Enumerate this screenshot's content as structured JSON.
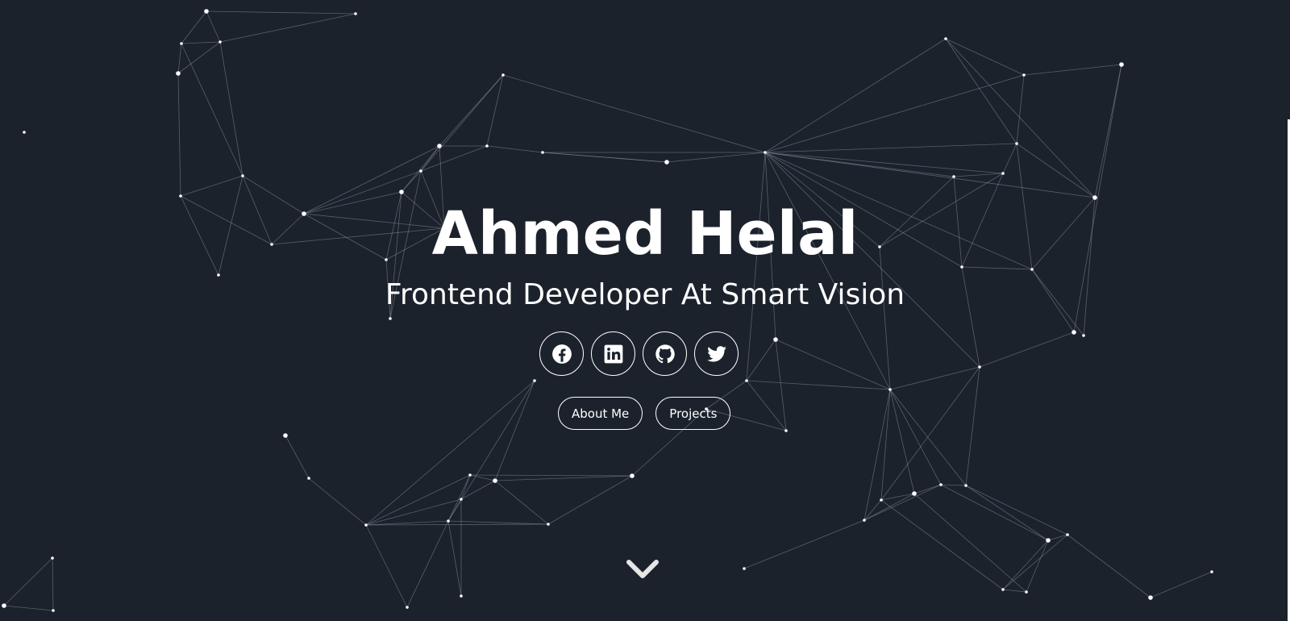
{
  "hero": {
    "name": "Ahmed Helal",
    "tagline": "Frontend Developer At Smart Vision"
  },
  "social_links": [
    {
      "icon": "facebook-icon"
    },
    {
      "icon": "linkedin-icon"
    },
    {
      "icon": "github-icon"
    },
    {
      "icon": "twitter-icon"
    }
  ],
  "nav_buttons": {
    "about_label": "About Me",
    "projects_label": "Projects"
  },
  "scroll": {
    "icon": "chevron-down-icon"
  },
  "colors": {
    "background": "#1b222c",
    "foreground": "#ffffff",
    "network_line": "#8a929e"
  }
}
